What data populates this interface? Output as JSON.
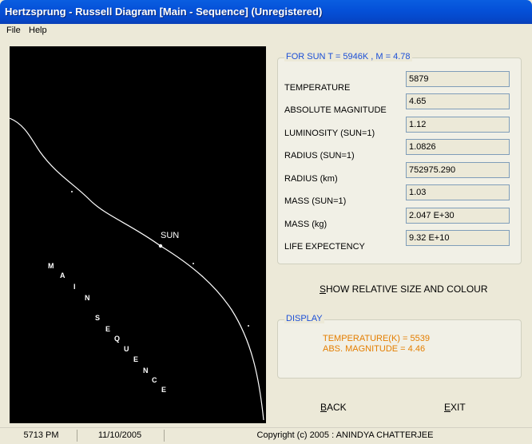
{
  "window": {
    "title": "Hertzsprung - Russell Diagram [Main - Sequence] (Unregistered)"
  },
  "menu": [
    "File",
    "Help"
  ],
  "diagram": {
    "sun_label": "SUN",
    "sequence_letters": [
      "M",
      "A",
      "I",
      "N",
      "S",
      "E",
      "Q",
      "U",
      "E",
      "N",
      "C",
      "E"
    ]
  },
  "sun_panel": {
    "title": "FOR SUN T = 5946K , M = 4.78",
    "rows": [
      {
        "label": "TEMPERATURE",
        "value": "5879"
      },
      {
        "label": "ABSOLUTE MAGNITUDE",
        "value": "4.65"
      },
      {
        "label": "LUMINOSITY (SUN=1)",
        "value": "1.12"
      },
      {
        "label": "RADIUS (SUN=1)",
        "value": "1.0826"
      },
      {
        "label": "RADIUS (km)",
        "value": "752975.290"
      },
      {
        "label": "MASS (SUN=1)",
        "value": "1.03"
      },
      {
        "label": "MASS (kg)",
        "value": "2.047 E+30"
      },
      {
        "label": "LIFE EXPECTENCY",
        "value": "9.32 E+10"
      }
    ]
  },
  "show_button": "SHOW RELATIVE SIZE AND COLOUR",
  "display_panel": {
    "title": "DISPLAY",
    "temperature": "TEMPERATURE(K) = 5539",
    "magnitude": "ABS. MAGNITUDE = 4.46"
  },
  "buttons": {
    "back": "BACK",
    "exit": "EXIT"
  },
  "status": {
    "time": "5713 PM",
    "date": "11/10/2005",
    "copyright": "Copyright (c) 2005 :  ANINDYA CHATTERJEE"
  },
  "colors": {
    "titlebar": "#0551d9",
    "accent_blue": "#1c4fd6",
    "display_orange": "#e47e00",
    "canvas": "#000000"
  }
}
